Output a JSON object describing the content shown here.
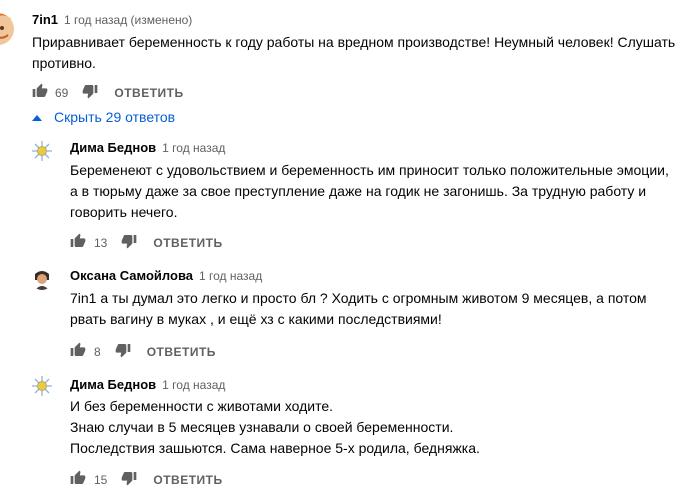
{
  "top_comment": {
    "author": "7in1",
    "time": "1 год назад (изменено)",
    "text_line1": "Приравнивает беременность к году работы на вредном производстве! Неумный человек! Слушать",
    "text_line2": "противно.",
    "likes": "69",
    "reply_label": "ОТВЕТИТЬ",
    "avatar_color": "#e8702a"
  },
  "replies_toggle": {
    "label": "Скрыть 29 ответов",
    "color": "#065fd4"
  },
  "replies": [
    {
      "author": "Дима Беднов",
      "time": "1 год назад",
      "lines": [
        "Беременеют с удовольствием и беременность им приносит только положительные эмоции,",
        "а в тюрьму даже за свое преступление даже на годик не загонишь. За трудную работу и",
        "говорить нечего."
      ],
      "likes": "13",
      "reply_label": "ОТВЕТИТЬ"
    },
    {
      "author": "Оксана Самойлова",
      "time": "1 год назад",
      "lines": [
        "7in1 а ты думал это легко и просто бл ? Ходить с огромным животом 9 месяцев, а потом",
        "рвать вагину в муках , и ещё хз с какими последствиями!"
      ],
      "likes": "8",
      "reply_label": "ОТВЕТИТЬ"
    },
    {
      "author": "Дима Беднов",
      "time": "1 год назад",
      "lines": [
        "И без беременности с животами ходите.",
        "Знаю случаи в 5 месяцев узнавали о своей беременности.",
        "Последствия зашьются. Сама наверное 5-х родила, бедняжка."
      ],
      "likes": "15",
      "reply_label": "ОТВЕТИТЬ"
    }
  ]
}
